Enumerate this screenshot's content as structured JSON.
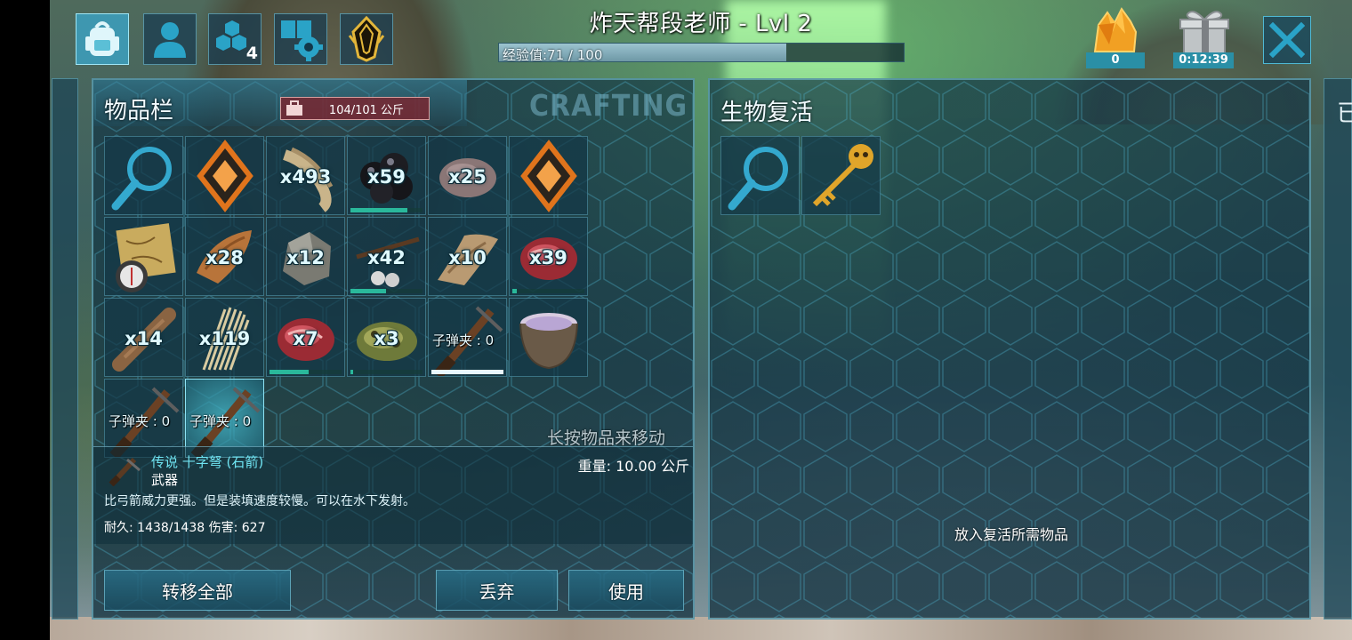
{
  "header": {
    "title": "炸天帮段老师 - Lvl 2",
    "xp_text": "经验值:71 / 100",
    "xp_progress": 0.71,
    "tribe_badge": "4",
    "element_count": "0",
    "gift_timer": "0:12:39"
  },
  "inventory": {
    "title": "物品栏",
    "weight": "104/101 公斤",
    "crafting_tab": "CRAFTING",
    "hint": "长按物品来移动",
    "slots": [
      {
        "icon": "search-icon",
        "qty": ""
      },
      {
        "icon": "implant-icon",
        "qty": ""
      },
      {
        "icon": "fiber-icon",
        "qty": "x493"
      },
      {
        "icon": "berries-icon",
        "qty": "x59",
        "bar": 0.77
      },
      {
        "icon": "stone-icon",
        "qty": "x25"
      },
      {
        "icon": "implant-icon",
        "qty": ""
      },
      {
        "icon": "map-icon",
        "qty": ""
      },
      {
        "icon": "hide-icon",
        "qty": "x28"
      },
      {
        "icon": "metal-ore-icon",
        "qty": "x12"
      },
      {
        "icon": "berries-stick-icon",
        "qty": "x42",
        "bar": 0.48
      },
      {
        "icon": "leather-icon",
        "qty": "x10"
      },
      {
        "icon": "raw-meat-icon",
        "qty": "x39",
        "bar": 0.06
      },
      {
        "icon": "wood-icon",
        "qty": "x14"
      },
      {
        "icon": "thatch-icon",
        "qty": "x119"
      },
      {
        "icon": "raw-meat-icon",
        "qty": "x7",
        "bar": 0.53
      },
      {
        "icon": "spoiled-meat-icon",
        "qty": "x3",
        "bar": 0.03
      },
      {
        "icon": "crossbow-icon",
        "ammo": "子弹夹 : 0",
        "bar": 0.98,
        "bar_white": true
      },
      {
        "icon": "mortar-icon",
        "qty": ""
      },
      {
        "icon": "crossbow-icon",
        "ammo": "子弹夹 : 0"
      },
      {
        "icon": "crossbow-icon",
        "ammo": "子弹夹 : 0",
        "selected": true
      }
    ]
  },
  "detail": {
    "name": "传说 十字弩 (石箭)",
    "type": "武器",
    "description": "比弓箭威力更强。但是装填速度较慢。可以在水下发射。",
    "stats": "耐久: 1438/1438 伤害: 627",
    "weight": "重量: 10.00 公斤"
  },
  "buttons": {
    "transfer_all": "转移全部",
    "drop": "丢弃",
    "use": "使用"
  },
  "revive": {
    "title": "生物复活",
    "hint": "放入复活所需物品",
    "slots": [
      {
        "icon": "search-icon"
      },
      {
        "icon": "skull-key-icon"
      }
    ]
  },
  "side_right_glyph": "已",
  "colors": {
    "accent": "#6fe4f2",
    "panel_border": "#82d2e6",
    "weight_badge": "#782832",
    "bar_green": "#2ab89b"
  }
}
